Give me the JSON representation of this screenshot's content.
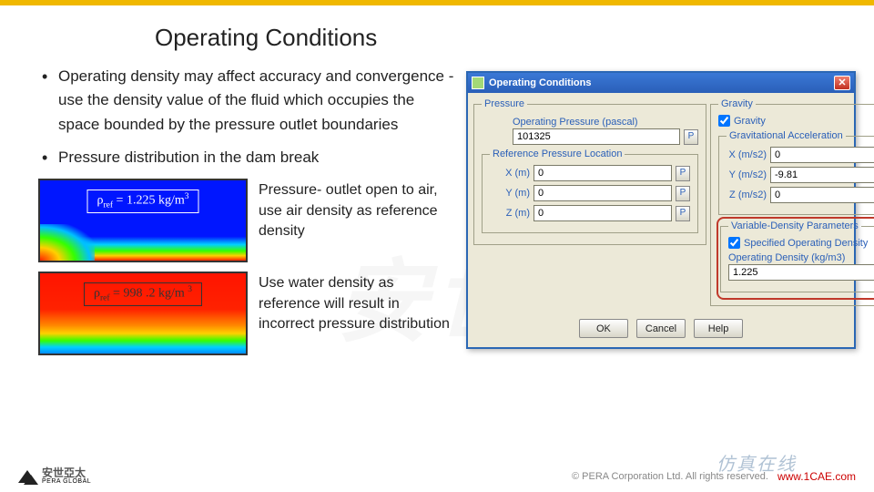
{
  "heading": "Operating Conditions",
  "bullets": [
    "Operating density may affect accuracy and convergence - use the density value of the fluid which occupies the space bounded by the pressure outlet boundaries",
    "Pressure distribution in the dam break"
  ],
  "plot1": {
    "rho_prefix": "ρ",
    "rho_sub": "ref",
    "eq": " = 1.225 kg/m",
    "sup": "3",
    "caption": "Pressure- outlet open to air, use air density as reference density"
  },
  "plot2": {
    "rho_prefix": "ρ",
    "rho_sub": "ref",
    "eq": "  = 998 .2 kg/m ",
    "sup": "3",
    "caption": "Use water density as reference will result in incorrect  pressure distribution"
  },
  "dialog": {
    "title": "Operating Conditions",
    "groups": {
      "pressure": {
        "legend": "Pressure",
        "op_pressure_label": "Operating Pressure (pascal)",
        "op_pressure_value": "101325",
        "ref_loc_legend": "Reference Pressure Location",
        "x_label": "X (m)",
        "x_value": "0",
        "y_label": "Y (m)",
        "y_value": "0",
        "z_label": "Z (m)",
        "z_value": "0"
      },
      "gravity": {
        "legend": "Gravity",
        "chk_label": "Gravity",
        "accel_label": "Gravitational Acceleration",
        "x_label": "X (m/s2)",
        "x_value": "0",
        "y_label": "Y (m/s2)",
        "y_value": "-9.81",
        "z_label": "Z (m/s2)",
        "z_value": "0"
      },
      "vdp": {
        "legend": "Variable-Density Parameters",
        "chk_label": "Specified Operating Density",
        "density_label": "Operating Density (kg/m3)",
        "density_value": "1.225"
      }
    },
    "buttons": {
      "ok": "OK",
      "cancel": "Cancel",
      "help": "Help"
    }
  },
  "footer": {
    "logo_text": "安世亞太",
    "logo_sub": "PERA GLOBAL",
    "copyright": "©   PERA Corporation Ltd. All rights reserved.",
    "wm_cn": "仿真在线",
    "wm_url": "www.1CAE.com"
  },
  "p_icon": "P"
}
